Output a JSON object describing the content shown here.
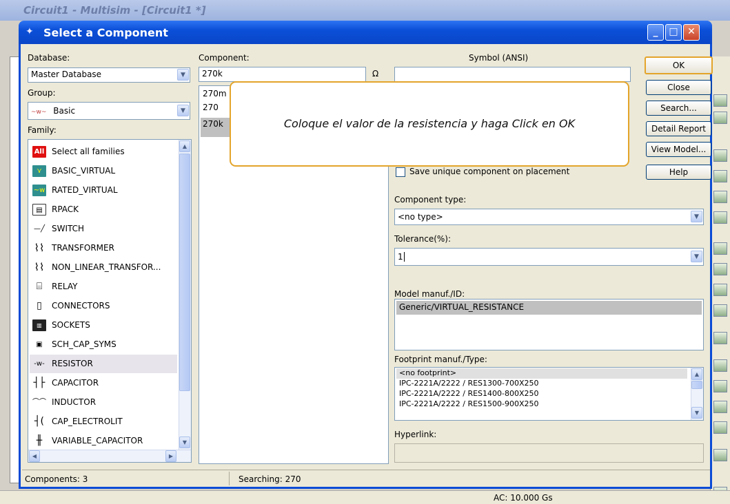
{
  "app": {
    "title": "Circuit1 - Multisim - [Circuit1 *]",
    "status_bar": {
      "ac": "AC: 10.000 Gs"
    }
  },
  "dialog": {
    "title": "Select a Component",
    "database": {
      "label": "Database:",
      "value": "Master Database"
    },
    "group": {
      "label": "Group:",
      "value": "Basic",
      "icon": "basic-group-icon"
    },
    "family": {
      "label": "Family:",
      "items": [
        {
          "label": "Select all families",
          "icon": "all-icon"
        },
        {
          "label": "BASIC_VIRTUAL",
          "icon": "basic-virtual-icon"
        },
        {
          "label": "RATED_VIRTUAL",
          "icon": "rated-virtual-icon"
        },
        {
          "label": "RPACK",
          "icon": "rpack-icon"
        },
        {
          "label": "SWITCH",
          "icon": "switch-icon"
        },
        {
          "label": "TRANSFORMER",
          "icon": "transformer-icon"
        },
        {
          "label": "NON_LINEAR_TRANSFOR...",
          "icon": "nonlinear-transformer-icon"
        },
        {
          "label": "RELAY",
          "icon": "relay-icon"
        },
        {
          "label": "CONNECTORS",
          "icon": "connectors-icon"
        },
        {
          "label": "SOCKETS",
          "icon": "sockets-icon"
        },
        {
          "label": "SCH_CAP_SYMS",
          "icon": "sch-cap-syms-icon"
        },
        {
          "label": "RESISTOR",
          "icon": "resistor-icon",
          "selected": true
        },
        {
          "label": "CAPACITOR",
          "icon": "capacitor-icon"
        },
        {
          "label": "INDUCTOR",
          "icon": "inductor-icon"
        },
        {
          "label": "CAP_ELECTROLIT",
          "icon": "cap-electrolit-icon"
        },
        {
          "label": "VARIABLE_CAPACITOR",
          "icon": "variable-capacitor-icon"
        }
      ]
    },
    "component": {
      "label": "Component:",
      "value": "270k",
      "unit": "Ω",
      "items": [
        "270m",
        "270",
        "270k"
      ]
    },
    "symbol": {
      "label": "Symbol (ANSI)"
    },
    "buttons": {
      "ok": "OK",
      "close": "Close",
      "search": "Search...",
      "detail_report": "Detail Report",
      "view_model": "View Model...",
      "help": "Help"
    },
    "save_unique": "Save unique component on placement",
    "component_type": {
      "label": "Component type:",
      "value": "<no type>"
    },
    "tolerance": {
      "label": "Tolerance(%):",
      "value": "1"
    },
    "model": {
      "label": "Model manuf./ID:",
      "value": "Generic/VIRTUAL_RESISTANCE"
    },
    "footprint": {
      "label": "Footprint manuf./Type:",
      "items": [
        "<no footprint>",
        "IPC-2221A/2222 / RES1300-700X250",
        "IPC-2221A/2222 / RES1400-800X250",
        "IPC-2221A/2222 / RES1500-900X250"
      ]
    },
    "hyperlink": {
      "label": "Hyperlink:"
    },
    "status": {
      "components": "Components: 3",
      "searching": "Searching: 270"
    },
    "callout": "Coloque el valor de la resistencia y haga Click en OK"
  }
}
